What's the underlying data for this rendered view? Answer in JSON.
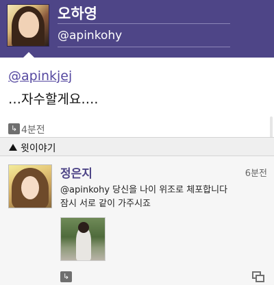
{
  "profile": {
    "name": "오하영",
    "handle": "@apinkohy"
  },
  "tweet": {
    "mention": "@apinkjej",
    "text": "…자수할게요….",
    "time": "4분전",
    "retweet_icon": "retweet-icon"
  },
  "section": {
    "title": "윗이야기",
    "icon": "triangle-up-icon"
  },
  "reply": {
    "name": "정은지",
    "time": "6분전",
    "text": "@apinkohy 당신을 나이 위조로 체포합니다\n잠시 서로 같이 가주시죠",
    "retweet_icon": "retweet-icon",
    "gallery_icon": "gallery-icon"
  },
  "colors": {
    "header_bg": "#4e4587",
    "link": "#5548a0",
    "section_bg": "#efefef",
    "reply_bg": "#f6f6f6"
  }
}
